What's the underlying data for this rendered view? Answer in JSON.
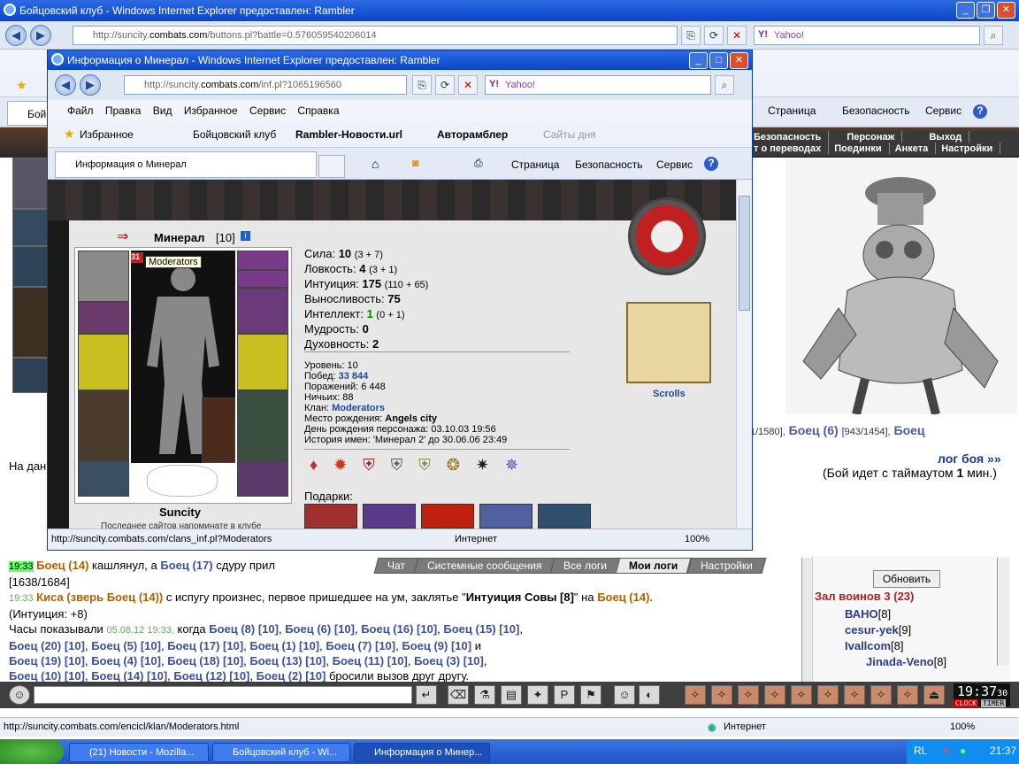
{
  "main_window": {
    "title": "Бойцовский клуб - Windows Internet Explorer предоставлен: Rambler",
    "url_prefix": "http://suncity.",
    "url_host": "combats.com",
    "url_rest": "/buttons.pl?battle=0.576059540206014",
    "search_placeholder": "Yahoo!",
    "tab_label": "Бойц",
    "toolbar_right": [
      "Страница",
      "Безопасность",
      "Сервис"
    ],
    "statusbar_url": "http://suncity.combats.com/encicl/klan/Moderators.html",
    "statusbar_zone": "Интернет",
    "zoom": "100%"
  },
  "game_menu": {
    "row1": [
      "Безопасность",
      "Персонаж",
      "Выход"
    ],
    "row2": [
      "т о переводах",
      "Поединки",
      "Анкета",
      "Настройки"
    ]
  },
  "game": {
    "fighters_text1": "1/1580],",
    "fighter_a": "Боец (6)",
    "fighter_a_hp": "[943/1454],",
    "fighter_b": "Боец",
    "log_link": "лог боя »»",
    "timeout_pre": "(Бой идет с таймаутом",
    "timeout_num": "1",
    "timeout_post": "мин.)",
    "left_text": "На дан"
  },
  "popup": {
    "title": "Информация о Минерал - Windows Internet Explorer предоставлен: Rambler",
    "url_prefix": "http://suncity.",
    "url_host": "combats.com",
    "url_rest": "/inf.pl?1065196560",
    "search_placeholder": "Yahoo!",
    "menu": [
      "Файл",
      "Правка",
      "Вид",
      "Избранное",
      "Сервис",
      "Справка"
    ],
    "favorites": "Избранное",
    "fav_links": [
      "Бойцовский клуб",
      "Rambler-Новости.url",
      "Авторамблер",
      "Сайты дня"
    ],
    "tab_label": "Информация о Минерал",
    "tools": [
      "Страница",
      "Безопасность",
      "Сервис"
    ],
    "status_url": "http://suncity.combats.com/clans_inf.pl?Moderators",
    "status_zone": "Интернет",
    "zoom": "100%"
  },
  "character": {
    "name": "Минерал",
    "level": "[10]",
    "tooltip": "Moderators",
    "badge": "31",
    "city": "Suncity",
    "city_sub": "Последнее сайтов  напоминате в клубе",
    "stats": [
      {
        "label": "Сила:",
        "value": "10",
        "extra": "(3 + 7)"
      },
      {
        "label": "Ловкость:",
        "value": "4",
        "extra": "(3 + 1)"
      },
      {
        "label": "Интуиция:",
        "value": "175",
        "extra": "(110 + 65)"
      },
      {
        "label": "Выносливость:",
        "value": "75",
        "extra": ""
      },
      {
        "label": "Интеллект:",
        "value": "1",
        "extra": "(0 + 1)"
      },
      {
        "label": "Мудрость:",
        "value": "0",
        "extra": ""
      },
      {
        "label": "Духовность:",
        "value": "2",
        "extra": ""
      }
    ],
    "level_line": "Уровень: 10",
    "wins_label": "Побед:",
    "wins": "33 844",
    "losses": "Поражений: 6 448",
    "draws": "Ничьих: 88",
    "clan_label": "Клан:",
    "clan": "Moderators",
    "birthplace_label": "Место рождения:",
    "birthplace": "Angels city",
    "birthday": "День рождения персонажа: 03.10.03 19:56",
    "names_history": "История имен: 'Минерал 2' до 30.06.06 23:49",
    "gifts": "Подарки:",
    "scrolls": "Scrolls"
  },
  "chat": {
    "tabs": [
      "Чат",
      "Системные сообщения",
      "Все логи",
      "Мои логи",
      "Настройки"
    ],
    "active_tab": "Мои логи",
    "l1_time": "19:33",
    "l1_a": "Боец (14)",
    "l1_mid": "кашлянул, а",
    "l1_b": "Боец (17)",
    "l1_end": "сдуру прил",
    "l2": "[1638/1684]",
    "l3_time": "19:33",
    "l3_a": "Киса (зверь Боец (14))",
    "l3_mid": "с испугу произнес, первое пришедшее на ум, заклятье \"",
    "l3_spell": "Интуиция Совы [8]",
    "l3_on": "\" на",
    "l3_b": "Боец (14).",
    "l4": "(Интуиция: +8)",
    "l5_pre": "Часы показывали",
    "l5_date": "05.08.12 19:33,",
    "l5_when": "когда",
    "row_names_1": [
      "Боец (8) [10]",
      ", ",
      "Боец (6) [10]",
      ", ",
      "Боец (16) [10]",
      ", ",
      "Боец (15) [10]",
      ","
    ],
    "row_names_2": [
      "Боец (20) [10]",
      ", ",
      "Боец (5) [10]",
      ", ",
      "Боец (17) [10]",
      ", ",
      "Боец (1) [10]",
      ", ",
      "Боец (7) [10]",
      ", ",
      "Боец (9) [10]",
      " и"
    ],
    "row_names_3": [
      "Боец (19) [10]",
      ", ",
      "Боец (4) [10]",
      ", ",
      "Боец (18) [10]",
      ", ",
      "Боец (13) [10]",
      ", ",
      "Боец (11) [10]",
      ", ",
      "Боец (3) [10]",
      ","
    ],
    "row_names_4": [
      "Боец (10) [10]",
      ", ",
      "Боец (14) [10]",
      ", ",
      "Боец (12) [10]",
      ", ",
      "Боец (2) [10]"
    ],
    "end": "бросили вызов друг другу."
  },
  "room": {
    "refresh": "Обновить",
    "title": "Зал воинов 3 (23)",
    "users": [
      {
        "name": "ВАНО",
        "lvl": "[8]"
      },
      {
        "name": "cesur-yek",
        "lvl": "[9]"
      },
      {
        "name": "Ivallcom",
        "lvl": "[8]"
      },
      {
        "name": "Jinada-Veno",
        "lvl": "[8]"
      }
    ]
  },
  "clock": {
    "time": "19:37",
    "sec": "30",
    "clock_label": "CLOCK",
    "timer_label": "TIMER"
  },
  "taskbar": {
    "tasks": [
      "(21) Новости - Mozilla...",
      "Бойцовский клуб - Wi...",
      "Информация о Минер..."
    ],
    "lang": "RL",
    "time": "21:37"
  }
}
